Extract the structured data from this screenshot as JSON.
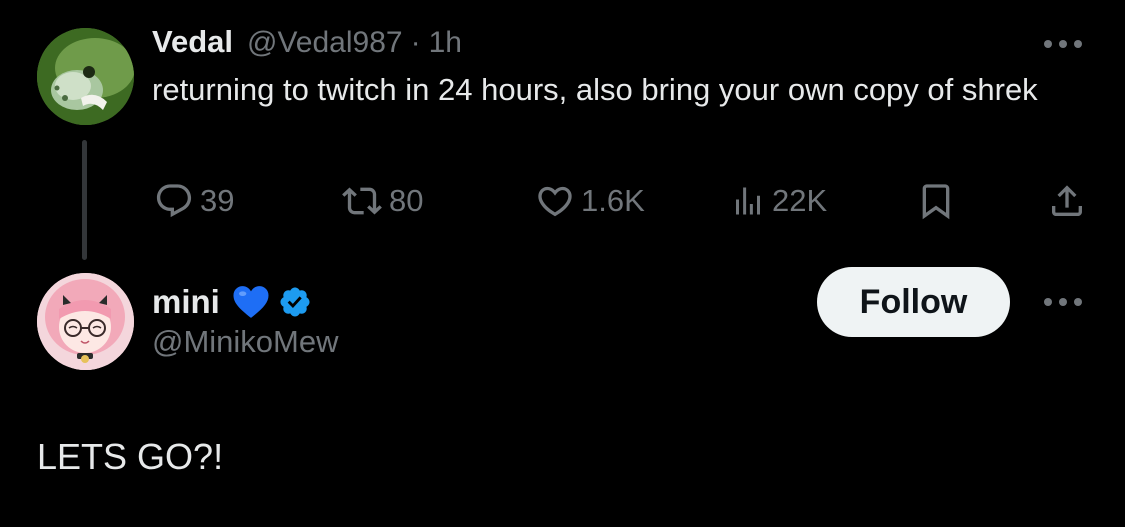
{
  "tweet1": {
    "author_name": "Vedal",
    "handle": "@Vedal987",
    "separator": "·",
    "time": "1h",
    "text": "returning to twitch in 24 hours, also bring your own copy of shrek",
    "more_icon": "more-horizontal-icon",
    "avatar_icon": "turtle-avatar",
    "actions": {
      "reply": {
        "icon": "reply-icon",
        "count": "39"
      },
      "retweet": {
        "icon": "retweet-icon",
        "count": "80"
      },
      "like": {
        "icon": "like-icon",
        "count": "1.6K"
      },
      "views": {
        "icon": "views-icon",
        "count": "22K"
      },
      "bookmark": {
        "icon": "bookmark-icon"
      },
      "share": {
        "icon": "share-icon"
      }
    }
  },
  "tweet2": {
    "author_name": "mini",
    "name_emoji": "blue-heart-emoji",
    "verified_icon": "verified-badge-icon",
    "handle": "@MinikoMew",
    "follow_label": "Follow",
    "more_icon": "more-horizontal-icon",
    "avatar_icon": "anime-girl-avatar",
    "text": "LETS GO?!"
  },
  "colors": {
    "background": "#000000",
    "primary_text": "#e7e9ea",
    "secondary_text": "#71767b",
    "thread_line": "#333639",
    "follow_button_bg": "#eff3f4",
    "verified_blue": "#1d9bf0",
    "heart_blue": "#1e6ef5"
  }
}
